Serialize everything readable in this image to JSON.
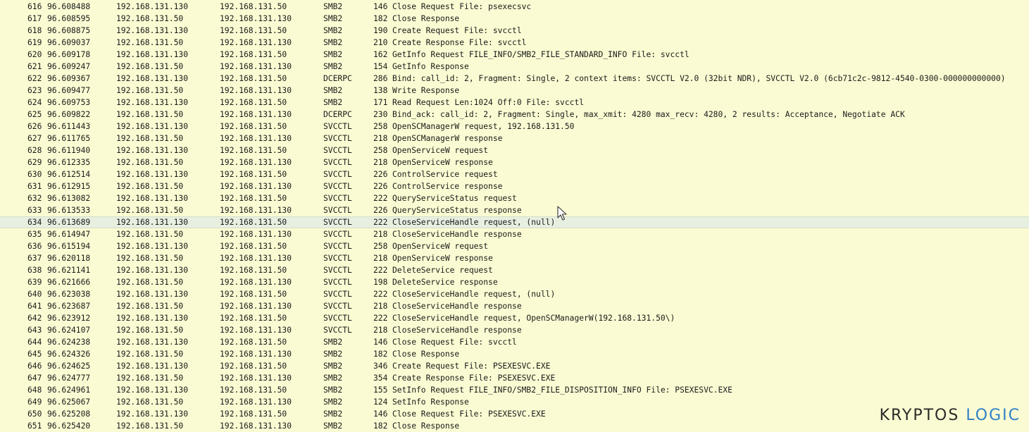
{
  "packets": [
    {
      "no": "616",
      "time": "96.608488",
      "src": "192.168.131.130",
      "dst": "192.168.131.50",
      "proto": "SMB2",
      "len": "146",
      "info": "Close Request File: psexecsvc"
    },
    {
      "no": "617",
      "time": "96.608595",
      "src": "192.168.131.50",
      "dst": "192.168.131.130",
      "proto": "SMB2",
      "len": "182",
      "info": "Close Response"
    },
    {
      "no": "618",
      "time": "96.608875",
      "src": "192.168.131.130",
      "dst": "192.168.131.50",
      "proto": "SMB2",
      "len": "190",
      "info": "Create Request File: svcctl"
    },
    {
      "no": "619",
      "time": "96.609037",
      "src": "192.168.131.50",
      "dst": "192.168.131.130",
      "proto": "SMB2",
      "len": "210",
      "info": "Create Response File: svcctl"
    },
    {
      "no": "620",
      "time": "96.609178",
      "src": "192.168.131.130",
      "dst": "192.168.131.50",
      "proto": "SMB2",
      "len": "162",
      "info": "GetInfo Request FILE_INFO/SMB2_FILE_STANDARD_INFO File: svcctl"
    },
    {
      "no": "621",
      "time": "96.609247",
      "src": "192.168.131.50",
      "dst": "192.168.131.130",
      "proto": "SMB2",
      "len": "154",
      "info": "GetInfo Response"
    },
    {
      "no": "622",
      "time": "96.609367",
      "src": "192.168.131.130",
      "dst": "192.168.131.50",
      "proto": "DCERPC",
      "len": "286",
      "info": "Bind: call_id: 2, Fragment: Single, 2 context items: SVCCTL V2.0 (32bit NDR), SVCCTL V2.0 (6cb71c2c-9812-4540-0300-000000000000)"
    },
    {
      "no": "623",
      "time": "96.609477",
      "src": "192.168.131.50",
      "dst": "192.168.131.130",
      "proto": "SMB2",
      "len": "138",
      "info": "Write Response"
    },
    {
      "no": "624",
      "time": "96.609753",
      "src": "192.168.131.130",
      "dst": "192.168.131.50",
      "proto": "SMB2",
      "len": "171",
      "info": "Read Request Len:1024 Off:0 File: svcctl"
    },
    {
      "no": "625",
      "time": "96.609822",
      "src": "192.168.131.50",
      "dst": "192.168.131.130",
      "proto": "DCERPC",
      "len": "230",
      "info": "Bind_ack: call_id: 2, Fragment: Single, max_xmit: 4280 max_recv: 4280, 2 results: Acceptance, Negotiate ACK"
    },
    {
      "no": "626",
      "time": "96.611443",
      "src": "192.168.131.130",
      "dst": "192.168.131.50",
      "proto": "SVCCTL",
      "len": "258",
      "info": "OpenSCManagerW request, 192.168.131.50"
    },
    {
      "no": "627",
      "time": "96.611765",
      "src": "192.168.131.50",
      "dst": "192.168.131.130",
      "proto": "SVCCTL",
      "len": "218",
      "info": "OpenSCManagerW response"
    },
    {
      "no": "628",
      "time": "96.611940",
      "src": "192.168.131.130",
      "dst": "192.168.131.50",
      "proto": "SVCCTL",
      "len": "258",
      "info": "OpenServiceW request"
    },
    {
      "no": "629",
      "time": "96.612335",
      "src": "192.168.131.50",
      "dst": "192.168.131.130",
      "proto": "SVCCTL",
      "len": "218",
      "info": "OpenServiceW response"
    },
    {
      "no": "630",
      "time": "96.612514",
      "src": "192.168.131.130",
      "dst": "192.168.131.50",
      "proto": "SVCCTL",
      "len": "226",
      "info": "ControlService request"
    },
    {
      "no": "631",
      "time": "96.612915",
      "src": "192.168.131.50",
      "dst": "192.168.131.130",
      "proto": "SVCCTL",
      "len": "226",
      "info": "ControlService response"
    },
    {
      "no": "632",
      "time": "96.613082",
      "src": "192.168.131.130",
      "dst": "192.168.131.50",
      "proto": "SVCCTL",
      "len": "222",
      "info": "QueryServiceStatus request"
    },
    {
      "no": "633",
      "time": "96.613533",
      "src": "192.168.131.50",
      "dst": "192.168.131.130",
      "proto": "SVCCTL",
      "len": "226",
      "info": "QueryServiceStatus response"
    },
    {
      "no": "634",
      "time": "96.613689",
      "src": "192.168.131.130",
      "dst": "192.168.131.50",
      "proto": "SVCCTL",
      "len": "222",
      "info": "CloseServiceHandle request, (null)",
      "selected": true
    },
    {
      "no": "635",
      "time": "96.614947",
      "src": "192.168.131.50",
      "dst": "192.168.131.130",
      "proto": "SVCCTL",
      "len": "218",
      "info": "CloseServiceHandle response"
    },
    {
      "no": "636",
      "time": "96.615194",
      "src": "192.168.131.130",
      "dst": "192.168.131.50",
      "proto": "SVCCTL",
      "len": "258",
      "info": "OpenServiceW request"
    },
    {
      "no": "637",
      "time": "96.620118",
      "src": "192.168.131.50",
      "dst": "192.168.131.130",
      "proto": "SVCCTL",
      "len": "218",
      "info": "OpenServiceW response"
    },
    {
      "no": "638",
      "time": "96.621141",
      "src": "192.168.131.130",
      "dst": "192.168.131.50",
      "proto": "SVCCTL",
      "len": "222",
      "info": "DeleteService request"
    },
    {
      "no": "639",
      "time": "96.621666",
      "src": "192.168.131.50",
      "dst": "192.168.131.130",
      "proto": "SVCCTL",
      "len": "198",
      "info": "DeleteService response"
    },
    {
      "no": "640",
      "time": "96.623038",
      "src": "192.168.131.130",
      "dst": "192.168.131.50",
      "proto": "SVCCTL",
      "len": "222",
      "info": "CloseServiceHandle request, (null)"
    },
    {
      "no": "641",
      "time": "96.623687",
      "src": "192.168.131.50",
      "dst": "192.168.131.130",
      "proto": "SVCCTL",
      "len": "218",
      "info": "CloseServiceHandle response"
    },
    {
      "no": "642",
      "time": "96.623912",
      "src": "192.168.131.130",
      "dst": "192.168.131.50",
      "proto": "SVCCTL",
      "len": "222",
      "info": "CloseServiceHandle request, OpenSCManagerW(192.168.131.50\\)"
    },
    {
      "no": "643",
      "time": "96.624107",
      "src": "192.168.131.50",
      "dst": "192.168.131.130",
      "proto": "SVCCTL",
      "len": "218",
      "info": "CloseServiceHandle response"
    },
    {
      "no": "644",
      "time": "96.624238",
      "src": "192.168.131.130",
      "dst": "192.168.131.50",
      "proto": "SMB2",
      "len": "146",
      "info": "Close Request File: svcctl"
    },
    {
      "no": "645",
      "time": "96.624326",
      "src": "192.168.131.50",
      "dst": "192.168.131.130",
      "proto": "SMB2",
      "len": "182",
      "info": "Close Response"
    },
    {
      "no": "646",
      "time": "96.624625",
      "src": "192.168.131.130",
      "dst": "192.168.131.50",
      "proto": "SMB2",
      "len": "346",
      "info": "Create Request File: PSEXESVC.EXE"
    },
    {
      "no": "647",
      "time": "96.624777",
      "src": "192.168.131.50",
      "dst": "192.168.131.130",
      "proto": "SMB2",
      "len": "354",
      "info": "Create Response File: PSEXESVC.EXE"
    },
    {
      "no": "648",
      "time": "96.624961",
      "src": "192.168.131.130",
      "dst": "192.168.131.50",
      "proto": "SMB2",
      "len": "155",
      "info": "SetInfo Request FILE_INFO/SMB2_FILE_DISPOSITION_INFO File: PSEXESVC.EXE"
    },
    {
      "no": "649",
      "time": "96.625067",
      "src": "192.168.131.50",
      "dst": "192.168.131.130",
      "proto": "SMB2",
      "len": "124",
      "info": "SetInfo Response"
    },
    {
      "no": "650",
      "time": "96.625208",
      "src": "192.168.131.130",
      "dst": "192.168.131.50",
      "proto": "SMB2",
      "len": "146",
      "info": "Close Request File: PSEXESVC.EXE"
    },
    {
      "no": "651",
      "time": "96.625420",
      "src": "192.168.131.50",
      "dst": "192.168.131.130",
      "proto": "SMB2",
      "len": "182",
      "info": "Close Response"
    }
  ],
  "brand": {
    "word1": "KRYPTOS",
    "word2": "LOGIC"
  },
  "colors": {
    "row_background": "#fbfbd3",
    "selected_row_background": "#e6efe0",
    "brand_accent": "#2f7fc7"
  },
  "icons": {
    "cursor": "mouse-pointer-arrow-icon"
  }
}
